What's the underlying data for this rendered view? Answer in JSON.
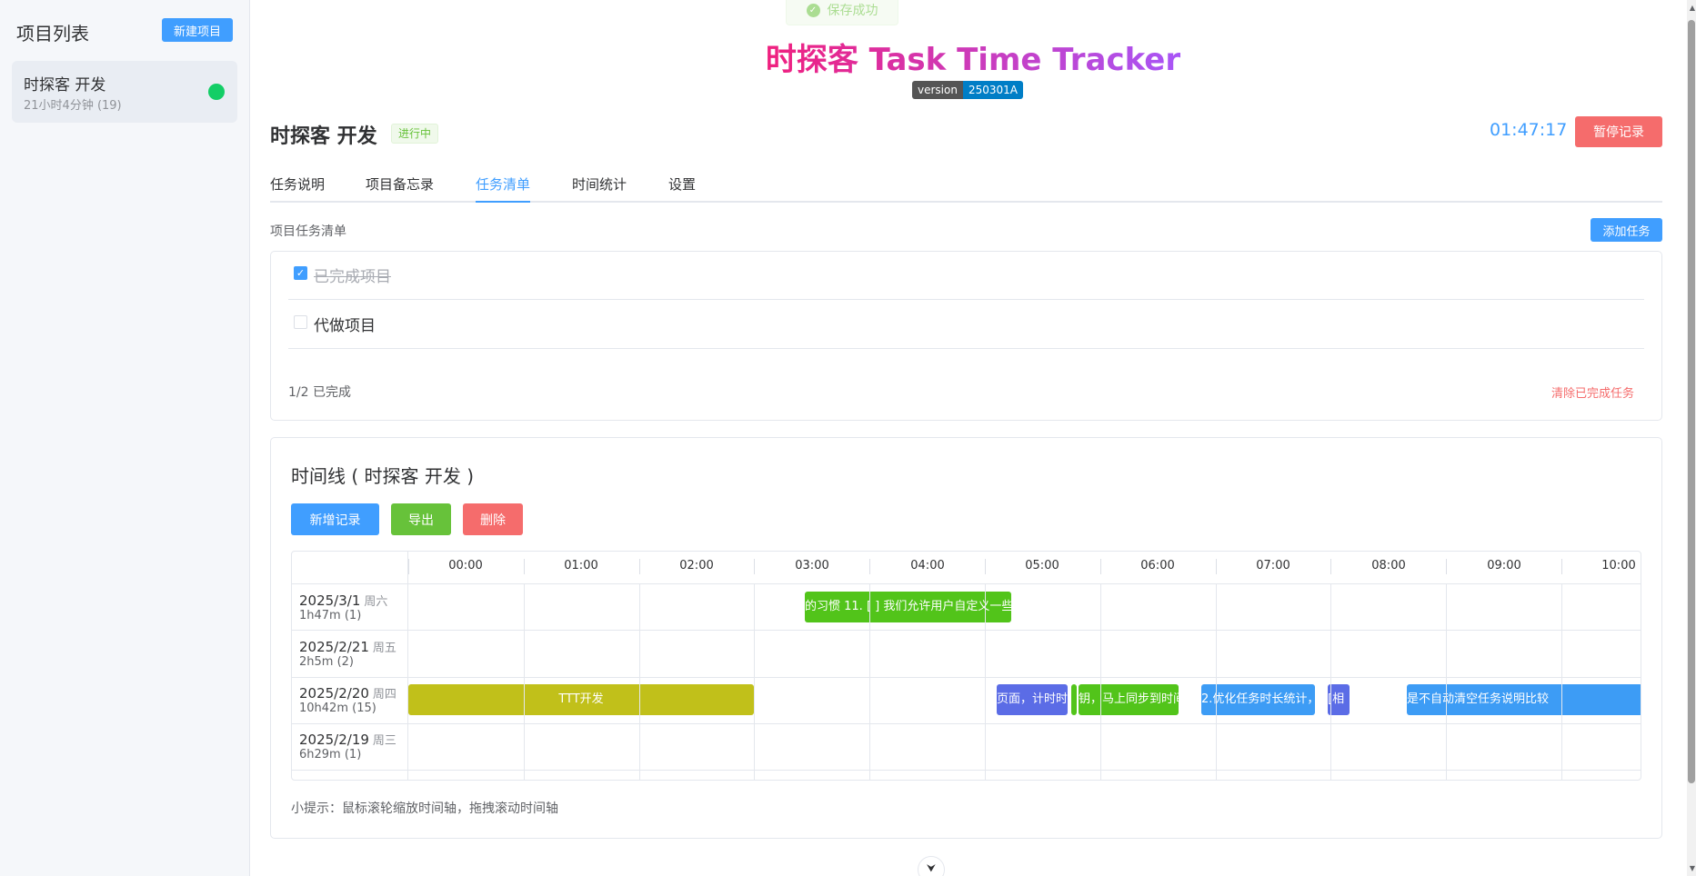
{
  "sidebar": {
    "title": "项目列表",
    "new_project_label": "新建项目",
    "projects": [
      {
        "name": "时探客 开发",
        "meta": "21小时4分钟 (19)",
        "status_color": "#13ce66"
      }
    ]
  },
  "toast": {
    "icon": "✓",
    "text": "保存成功"
  },
  "app": {
    "title": "时探客 Task Time Tracker",
    "version_label": "version",
    "version_value": "250301A"
  },
  "project": {
    "title": "时探客 开发",
    "status": "进行中",
    "timer": "01:47:17",
    "pause_label": "暂停记录"
  },
  "tabs": [
    {
      "label": "任务说明",
      "active": false
    },
    {
      "label": "项目备忘录",
      "active": false
    },
    {
      "label": "任务清单",
      "active": true
    },
    {
      "label": "时间统计",
      "active": false
    },
    {
      "label": "设置",
      "active": false
    }
  ],
  "tasks": {
    "section_label": "项目任务清单",
    "add_label": "添加任务",
    "items": [
      {
        "text": "已完成项目",
        "done": true,
        "check_glyph": "✓"
      },
      {
        "text": "代做项目",
        "done": false,
        "check_glyph": ""
      }
    ],
    "progress": "1/2 已完成",
    "clear_label": "清除已完成任务"
  },
  "timeline": {
    "title": "时间线 ( 时探客 开发 )",
    "buttons": {
      "add": "新增记录",
      "export": "导出",
      "delete": "删除"
    },
    "hours": [
      "00:00",
      "01:00",
      "02:00",
      "03:00",
      "04:00",
      "05:00",
      "06:00",
      "07:00",
      "08:00",
      "09:00",
      "10:00"
    ],
    "rows": [
      {
        "date": "2025/3/1",
        "weekday": "周六",
        "meta": "1h47m (1)"
      },
      {
        "date": "2025/2/21",
        "weekday": "周五",
        "meta": "2h5m (2)"
      },
      {
        "date": "2025/2/20",
        "weekday": "周四",
        "meta": "10h42m (15)"
      },
      {
        "date": "2025/2/19",
        "weekday": "周三",
        "meta": "6h29m (1)"
      }
    ],
    "events": [
      {
        "text": "的习惯 11. [ ] 我们允许用户自定义一些",
        "color": "#52c41a"
      },
      {
        "text": "TTT开发",
        "color": "#c1c01a"
      },
      {
        "text": "页面，计时时",
        "color": "#5b6ce6"
      },
      {
        "text": "",
        "color": "#52c41a"
      },
      {
        "text": "钥，马上同步到时间",
        "color": "#52c41a"
      },
      {
        "text": "2.优化任务时长统计，",
        "color": "#3d9cf5"
      },
      {
        "text": "[相",
        "color": "#5b6ce6"
      },
      {
        "text": "是不自动清空任务说明比较",
        "color": "#3d9cf5"
      }
    ],
    "hint": "小提示：鼠标滚轮缩放时间轴，拖拽滚动时间轴"
  },
  "colors": {
    "primary": "#409eff",
    "success": "#67c23a",
    "danger": "#f56c6c",
    "active_dot": "#13ce66"
  }
}
